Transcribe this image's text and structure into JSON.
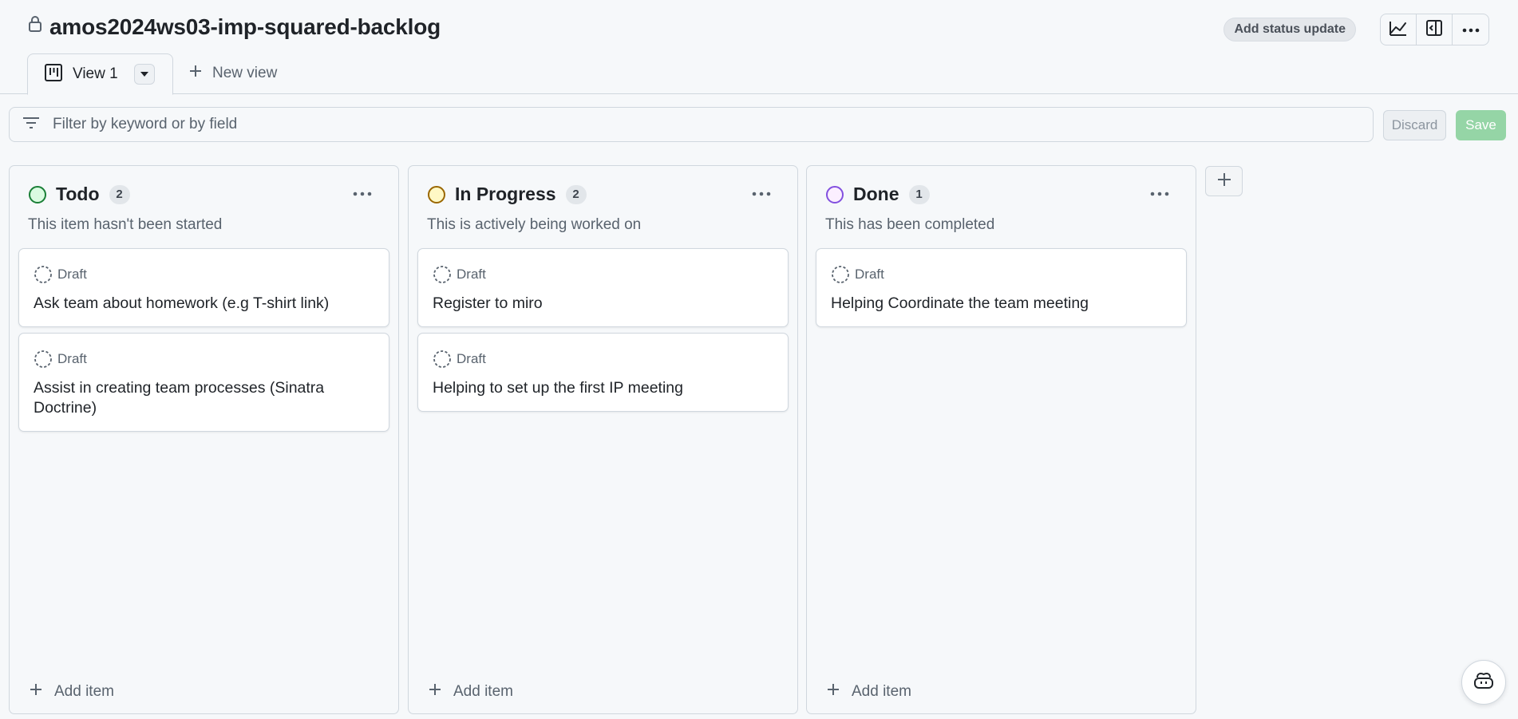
{
  "header": {
    "title": "amos2024ws03-imp-squared-backlog",
    "status_update_label": "Add status update",
    "icons": [
      "lock-icon",
      "insights-graph-icon",
      "side-panel-icon",
      "kebab-menu-icon"
    ]
  },
  "tabs": {
    "active_label": "View 1",
    "new_view_label": "New view"
  },
  "filter": {
    "placeholder": "Filter by keyword or by field",
    "value": "",
    "discard_label": "Discard",
    "save_label": "Save"
  },
  "columns": [
    {
      "name": "Todo",
      "count": "2",
      "description": "This item hasn't been started",
      "color": "#1a7f37",
      "add_item_label": "Add item",
      "cards": [
        {
          "status": "Draft",
          "title": "Ask team about homework (e.g T-shirt link)"
        },
        {
          "status": "Draft",
          "title": "Assist in creating team processes (Sinatra Doctrine)"
        }
      ]
    },
    {
      "name": "In Progress",
      "count": "2",
      "description": "This is actively being worked on",
      "color": "#9a6700",
      "add_item_label": "Add item",
      "cards": [
        {
          "status": "Draft",
          "title": "Register to miro"
        },
        {
          "status": "Draft",
          "title": "Helping to set up the first IP meeting"
        }
      ]
    },
    {
      "name": "Done",
      "count": "1",
      "description": "This has been completed",
      "color": "#8250df",
      "add_item_label": "Add item",
      "cards": [
        {
          "status": "Draft",
          "title": "Helping Coordinate the team meeting"
        }
      ]
    }
  ],
  "colors": {
    "save_button": "#95d5a6",
    "border": "#d0d7de",
    "muted_text": "#59636e"
  }
}
